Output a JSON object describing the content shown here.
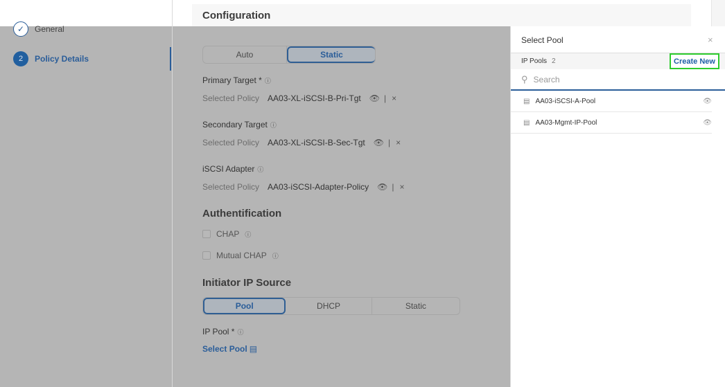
{
  "wizard": {
    "steps": [
      {
        "label": "General",
        "state": "done"
      },
      {
        "number": "2",
        "label": "Policy Details",
        "state": "active"
      }
    ]
  },
  "main": {
    "title": "Configuration",
    "mode_toggle": {
      "options": [
        "Auto",
        "Static"
      ],
      "selected": "Static"
    },
    "fields": [
      {
        "label": "Primary Target *",
        "prefix": "Selected Policy",
        "value": "AA03-XL-iSCSI-B-Pri-Tgt"
      },
      {
        "label": "Secondary Target",
        "prefix": "Selected Policy",
        "value": "AA03-XL-iSCSI-B-Sec-Tgt"
      },
      {
        "label": "iSCSI Adapter",
        "prefix": "Selected Policy",
        "value": "AA03-iSCSI-Adapter-Policy"
      }
    ],
    "auth": {
      "title": "Authentification",
      "options": [
        "CHAP",
        "Mutual CHAP"
      ]
    },
    "initiator": {
      "title": "Initiator IP Source",
      "options": [
        "Pool",
        "DHCP",
        "Static"
      ],
      "selected": "Pool",
      "ip_pool_label": "IP Pool *",
      "select_pool": "Select Pool"
    }
  },
  "panel": {
    "title": "Select Pool",
    "close": "×",
    "list_label": "IP Pools",
    "count": "2",
    "create_new": "Create New",
    "search_placeholder": "Search",
    "items": [
      "AA03-iSCSI-A-Pool",
      "AA03-Mgmt-IP-Pool"
    ]
  },
  "colors": {
    "accent": "#1d5fa6",
    "highlight": "#2ecc2e"
  }
}
